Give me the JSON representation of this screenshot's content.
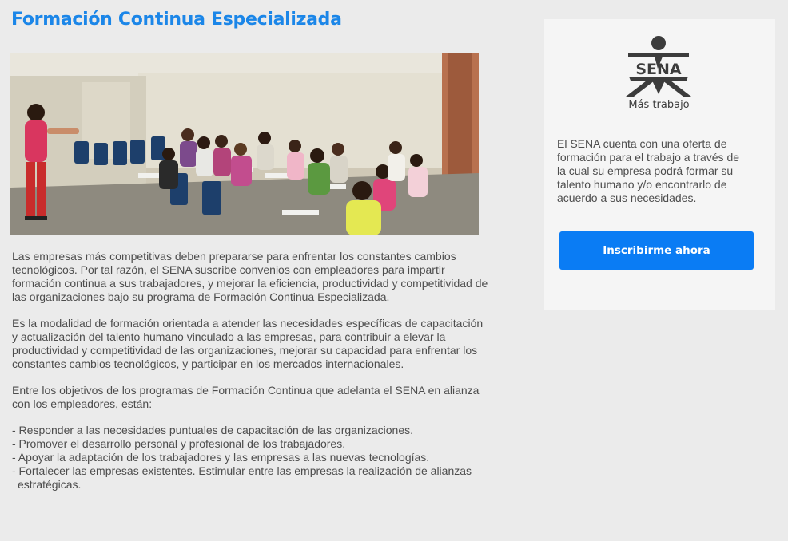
{
  "header": {
    "title": "Formación Continua Especializada"
  },
  "hero_image": {
    "icon": "classroom-photo"
  },
  "main": {
    "paragraphs": [
      "Las empresas más competitivas deben prepararse para enfrentar los constantes cambios tecnológicos. Por tal razón, el SENA suscribe convenios con empleadores para impartir formación continua a sus  trabajadores, y mejorar la eficiencia, productividad y competitividad de las organizaciones bajo su programa de Formación Continua Especializada.",
      "Es la modalidad de formación orientada a atender las necesidades específicas de capacitación y actualización del talento humano vinculado a las empresas, para contribuir a elevar la productividad y competitividad de las organizaciones, mejorar su capacidad para enfrentar los constantes cambios  tecnológicos, y participar en los mercados internacionales.",
      "Entre los objetivos de los programas de Formación Continua que adelanta el SENA en alianza con los empleadores, están:"
    ],
    "objectives": [
      "- Responder a las necesidades puntuales de capacitación de las organizaciones.",
      "- Promover el desarrollo personal y profesional de los trabajadores.",
      "- Apoyar la adaptación de los trabajadores y las empresas a las nuevas tecnologías.",
      "- Fortalecer las empresas existentes. Estimular entre las empresas la realización de alianzas estratégicas."
    ]
  },
  "sidebar": {
    "logo_text": "SENA",
    "tagline": "Más trabajo",
    "description": "El SENA cuenta con una oferta de formación para el trabajo a través de la cual su empresa podrá formar su talento humano y/o encontrarlo de acuerdo a sus necesidades.",
    "button_label": "Inscribirme ahora"
  },
  "colors": {
    "accent": "#1b86e8",
    "button": "#0a7cf4",
    "background": "#ebebeb",
    "card": "#f5f5f5",
    "body_text": "#4d4d4d"
  }
}
